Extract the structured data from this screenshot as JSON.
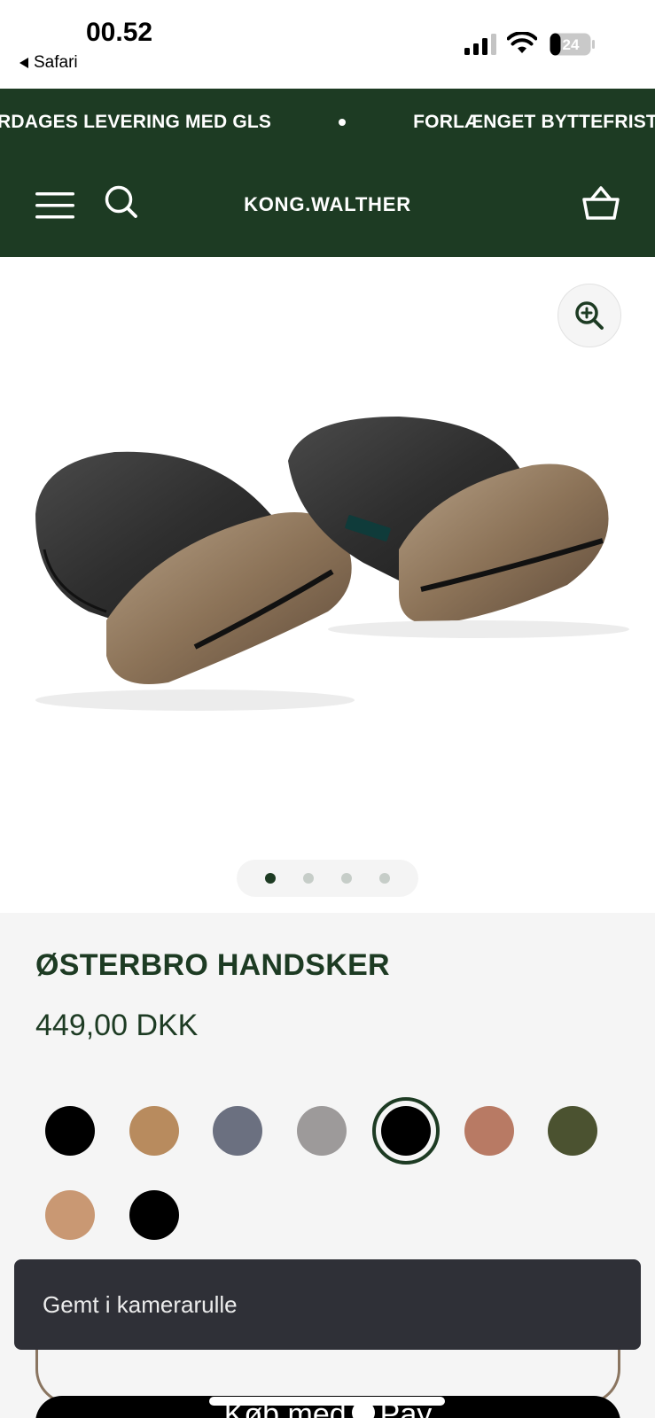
{
  "status_bar": {
    "time": "00.52",
    "back_app": "Safari",
    "battery_level": "24"
  },
  "announcement": {
    "items": [
      "RDAGES LEVERING MED GLS",
      "FORLÆNGET BYTTEFRIST"
    ]
  },
  "header": {
    "logo": "KONG.WALTHER",
    "icons": [
      "menu-icon",
      "search-icon",
      "cart-icon"
    ]
  },
  "gallery": {
    "zoom_icon": "zoom-in-icon",
    "slide_count": 4,
    "active_slide": 1
  },
  "product": {
    "title": "ØSTERBRO HANDSKER",
    "price": "449,00 DKK",
    "colors": [
      "#000000",
      "#b88b5e",
      "#6b7080",
      "#9d9a9a",
      "#000000",
      "#b87a64",
      "#4b5230",
      "#c99873",
      "#000000"
    ],
    "selected_color_index": 4
  },
  "buttons": {
    "pay_label_prefix": "Køb med",
    "pay_label_suffix": "Pay"
  },
  "toast": {
    "message": "Gemt i kamerarulle"
  },
  "colors": {
    "brand_green": "#1d3b23",
    "toast_bg": "#2f3037"
  }
}
